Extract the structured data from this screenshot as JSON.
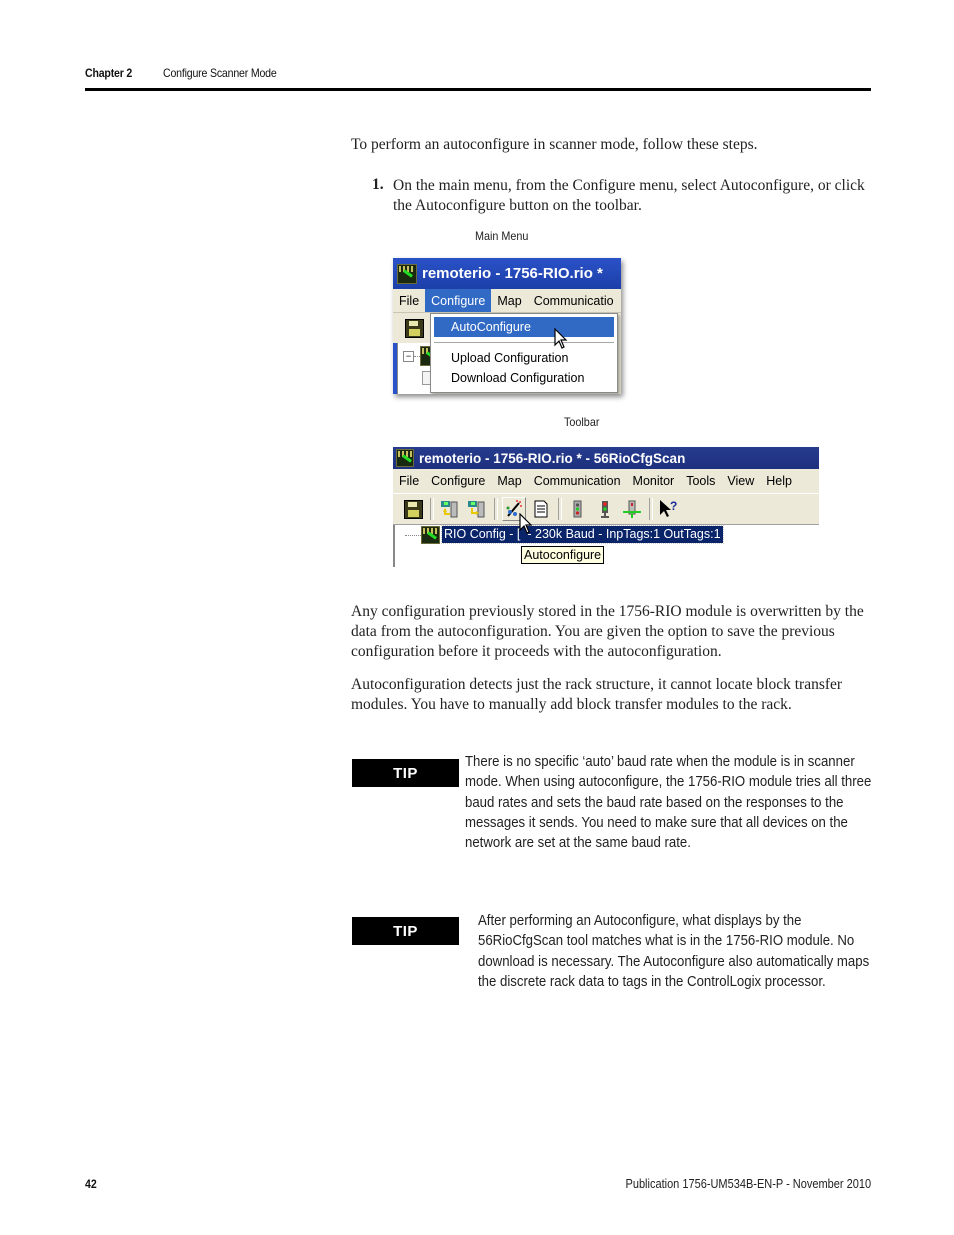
{
  "header": {
    "chapter": "Chapter 2",
    "section": "Configure Scanner Mode"
  },
  "intro": "To perform an autoconfigure in scanner mode, follow these steps.",
  "steps": [
    {
      "number": "1.",
      "text": "On the main menu, from the Configure menu, select Autoconfigure, or click the Autoconfigure button on the toolbar."
    }
  ],
  "figure_main_menu": {
    "caption": "Main Menu",
    "window_title": "remoterio - 1756-RIO.rio *",
    "menu": [
      "File",
      "Configure",
      "Map",
      "Communicatio"
    ],
    "active_menu": "Configure",
    "dropdown_items": [
      "AutoConfigure",
      "Upload Configuration",
      "Download Configuration"
    ],
    "highlighted_item": "AutoConfigure",
    "tree_expander": "−"
  },
  "figure_toolbar": {
    "caption": "Toolbar",
    "window_title": "remoterio - 1756-RIO.rio * - 56RioCfgScan",
    "menu": [
      "File",
      "Configure",
      "Map",
      "Communication",
      "Monitor",
      "Tools",
      "View",
      "Help"
    ],
    "toolbar_icons": [
      "save-icon",
      "upload-icon",
      "download-icon",
      "autoconfigure-icon",
      "report-icon",
      "run-mode-icon",
      "stop-mode-icon",
      "online-icon",
      "help-pointer-icon"
    ],
    "tree_node": "RIO Config - [  - 230k Baud - InpTags:1 OutTags:1",
    "tooltip": "Autoconfigure"
  },
  "paragraphs": [
    "Any configuration previously stored in the 1756-RIO module is overwritten by the data from the autoconfiguration. You are given the option to save the previous configuration before it proceeds with the autoconfiguration.",
    "Autoconfiguration detects just the rack structure, it cannot locate block transfer modules. You have to manually add block transfer modules to the rack."
  ],
  "tips": [
    {
      "label": "TIP",
      "text": "There is no specific ‘auto’ baud rate when the module is in scanner mode. When using autoconfigure, the 1756-RIO module tries all three baud rates and sets the baud rate based on the responses to the messages it sends. You need to make sure that all devices on the network are set at the same baud rate."
    },
    {
      "label": "TIP",
      "text": "After performing an Autoconfigure, what displays by the 56RioCfgScan tool matches what is in the 1756-RIO module. No download is necessary. The Autoconfigure also automatically maps the discrete rack data to tags in the ControlLogix processor."
    }
  ],
  "footer": {
    "page_number": "42",
    "publication": "Publication 1756-UM534B-EN-P - November 2010"
  }
}
